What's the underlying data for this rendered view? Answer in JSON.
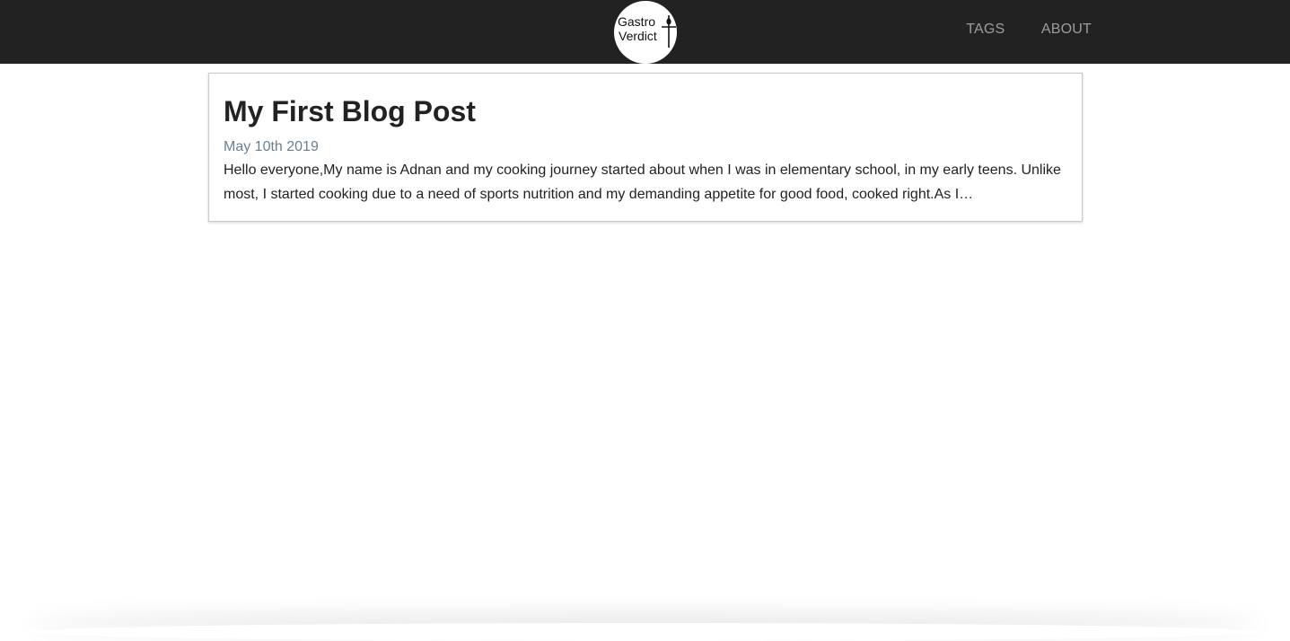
{
  "header": {
    "logo": {
      "line1": "Gastro",
      "line2": "Verdict"
    },
    "nav": [
      {
        "label": "TAGS"
      },
      {
        "label": "ABOUT"
      }
    ]
  },
  "posts": [
    {
      "title": "My First Blog Post",
      "date": "May 10th 2019",
      "excerpt": "Hello everyone,My name is Adnan and my cooking journey started about when I was in elementary school, in my early teens. Unlike most, I started cooking due to a need of sports nutrition and my demanding appetite for good food, cooked right.As I…"
    }
  ],
  "colors": {
    "navbar": "#222222",
    "nav_link": "#9d9d9d",
    "date": "#6a8090",
    "text": "#222222"
  }
}
